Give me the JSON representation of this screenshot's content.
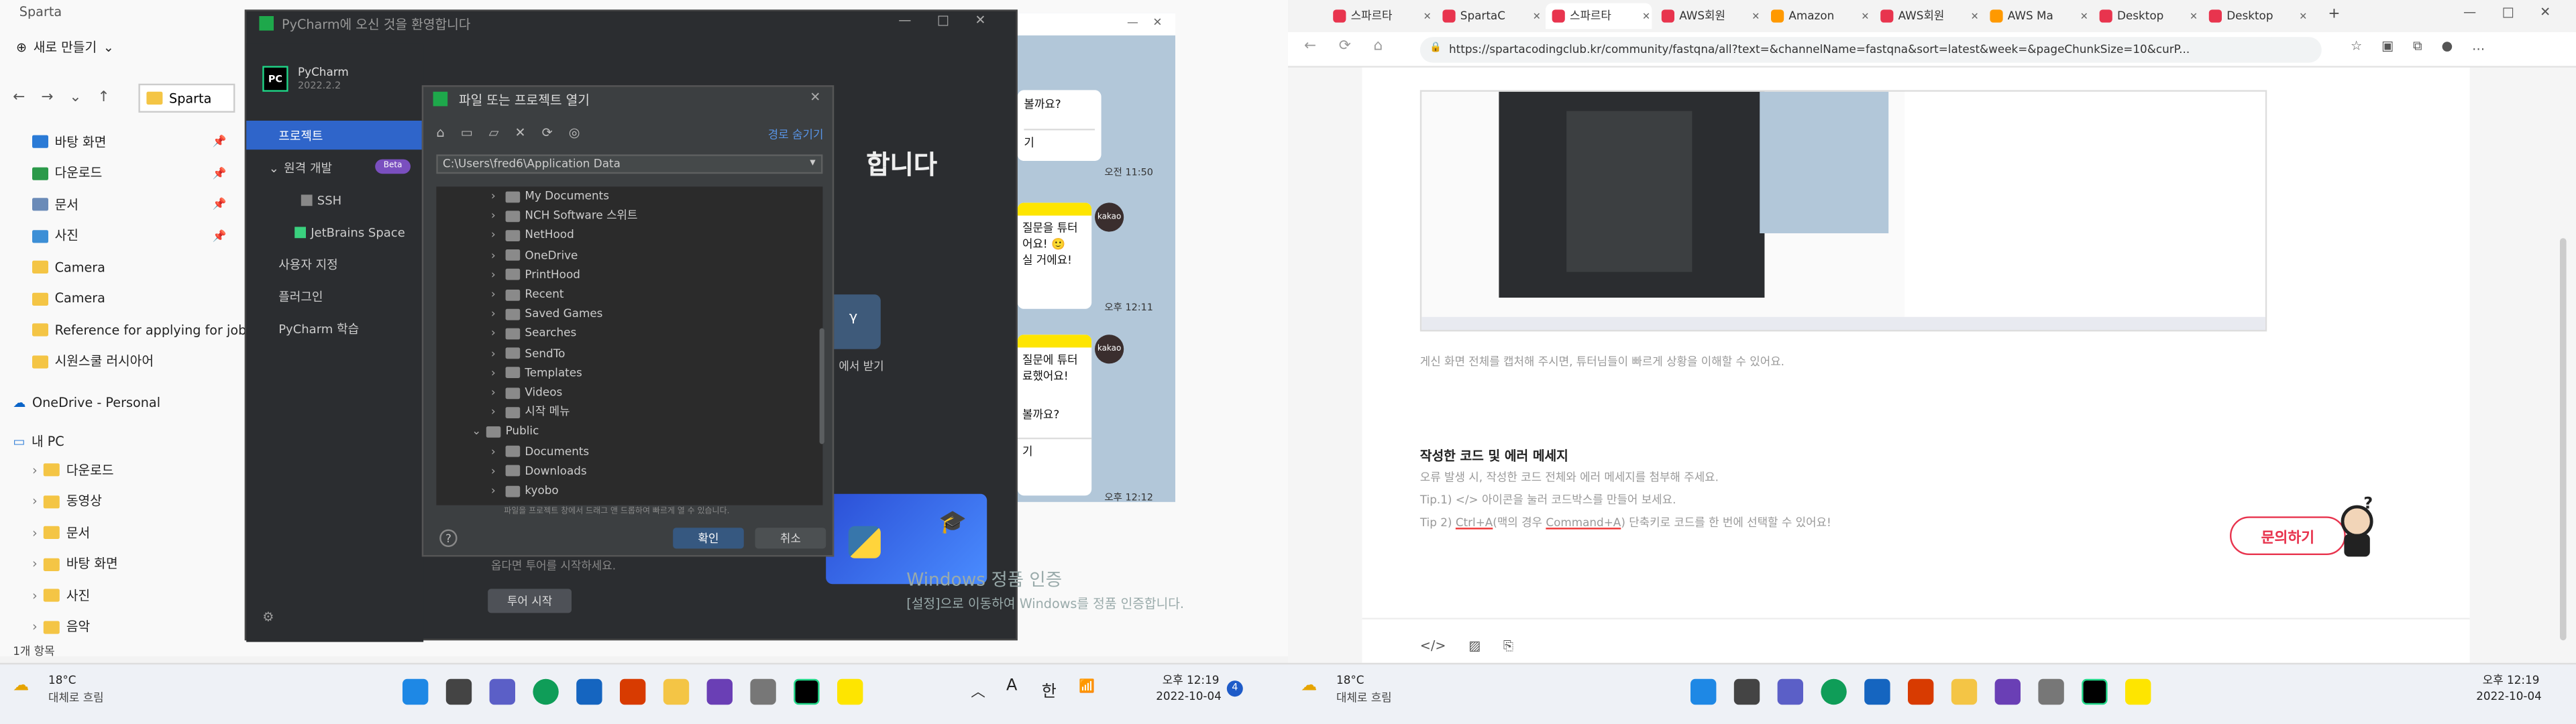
{
  "left": {
    "explorer": {
      "title": "Sparta",
      "new_button": "새로 만들기",
      "address": "Sparta",
      "quick_items": [
        {
          "label": "바탕 화면"
        },
        {
          "label": "다운로드"
        },
        {
          "label": "문서"
        },
        {
          "label": "사진"
        },
        {
          "label": "Camera"
        },
        {
          "label": "Camera"
        },
        {
          "label": "Reference for applying for job"
        },
        {
          "label": "시원스쿨 러시아어"
        }
      ],
      "onedrive": "OneDrive - Personal",
      "pc": "내 PC",
      "pc_items": [
        {
          "label": "다운로드"
        },
        {
          "label": "동영상"
        },
        {
          "label": "문서"
        },
        {
          "label": "바탕 화면"
        },
        {
          "label": "사진"
        },
        {
          "label": "음악"
        }
      ],
      "status": "1개 항목"
    },
    "pycharm": {
      "welcome_title": "PyCharm에 오신 것을 환영합니다",
      "brand": "PyCharm",
      "version": "2022.2.2",
      "nav": [
        {
          "label": "프로젝트"
        },
        {
          "label": "원격 개발"
        },
        {
          "label": "SSH"
        },
        {
          "label": "JetBrains Space"
        },
        {
          "label": "사용자 지정"
        },
        {
          "label": "플러그인"
        },
        {
          "label": "PyCharm 학습"
        }
      ],
      "beta_badge": "Beta",
      "tour_button": "투어 시작",
      "side_text": "합니다",
      "side_text2": "에서 받기",
      "small_text": "옵다면 투어를 시작하세요.",
      "dialog": {
        "title": "파일 또는 프로젝트 열기",
        "hide_path": "경로 숨기기",
        "path": "C:\\Users\\fred6\\Application Data",
        "hint": "파일을 프로젝트 창에서 드래그 앤 드롭하여 빠르게 열 수 있습니다.",
        "ok": "확인",
        "cancel": "취소",
        "help": "?",
        "tree": [
          {
            "label": "My Documents",
            "level": 1,
            "open": false
          },
          {
            "label": "NCH Software 스위트",
            "level": 1,
            "open": false
          },
          {
            "label": "NetHood",
            "level": 1,
            "open": false
          },
          {
            "label": "OneDrive",
            "level": 1,
            "open": false
          },
          {
            "label": "PrintHood",
            "level": 1,
            "open": false
          },
          {
            "label": "Recent",
            "level": 1,
            "open": false
          },
          {
            "label": "Saved Games",
            "level": 1,
            "open": false
          },
          {
            "label": "Searches",
            "level": 1,
            "open": false
          },
          {
            "label": "SendTo",
            "level": 1,
            "open": false
          },
          {
            "label": "Templates",
            "level": 1,
            "open": false
          },
          {
            "label": "Videos",
            "level": 1,
            "open": false
          },
          {
            "label": "시작 메뉴",
            "level": 1,
            "open": false
          },
          {
            "label": "Public",
            "level": 0,
            "open": true
          },
          {
            "label": "Documents",
            "level": 1,
            "open": false
          },
          {
            "label": "Downloads",
            "level": 1,
            "open": false
          },
          {
            "label": "kyobo",
            "level": 1,
            "open": false
          }
        ]
      }
    },
    "chat": {
      "msgs": [
        {
          "text": "볼까요?"
        },
        {
          "text": "기"
        },
        {
          "text": "질문을 튜터\n어요! 🙂\n실 거에요!"
        },
        {
          "text": "질문에 튜터\n료했어요!"
        },
        {
          "text": "볼까요?"
        },
        {
          "text": "기"
        }
      ],
      "times": [
        "오전 11:50",
        "오후 12:11",
        "오후 12:12"
      ],
      "avatar": "kakao"
    },
    "watermark": {
      "line1": "Windows 정품 인증",
      "line2": "[설정]으로 이동하여 Windows를 정품 인증합니다."
    },
    "taskbar": {
      "weather_temp": "18°C",
      "weather_desc": "대체로 흐림",
      "time": "오후 12:19",
      "date": "2022-10-04",
      "lang1": "A",
      "lang2": "한",
      "badge": "4"
    }
  },
  "right": {
    "tabs": [
      {
        "label": "스파르타"
      },
      {
        "label": "SpartaC"
      },
      {
        "label": "스파르타"
      },
      {
        "label": "AWS회원"
      },
      {
        "label": "Amazon"
      },
      {
        "label": "AWS회원"
      },
      {
        "label": "AWS Ma"
      },
      {
        "label": "Desktop"
      },
      {
        "label": "Desktop"
      }
    ],
    "url": "https://spartacodingclub.kr/community/fastqna/all?text=&channelName=fastqna&sort=latest&week=&pageChunkSize=10&curP...",
    "caption": "게신 화면 전체를 캡처해 주시면, 튜터님들이 빠르게 상황을 이해할 수 있어요.",
    "section_title": "작성한 코드 및 에러 메세지",
    "p1": "오류 발생 시, 작성한 코드 전체와 에러 메세지를 첨부해 주세요.",
    "tip1": "Tip.1) </> 아이콘을 눌러 코드박스를 만들어 보세요.",
    "tip2_pre": "Tip 2) ",
    "tip2_k1": "Ctrl+A",
    "tip2_mid": "(맥의 경우 ",
    "tip2_k2": "Command+A",
    "tip2_post": ") 단축키로 코드를 한 번에 선택할 수 있어요!",
    "inquiry": "문의하기",
    "taskbar": {
      "weather_temp": "18°C",
      "weather_desc": "대체로 흐림",
      "time": "오후 12:19",
      "date": "2022-10-04"
    }
  }
}
